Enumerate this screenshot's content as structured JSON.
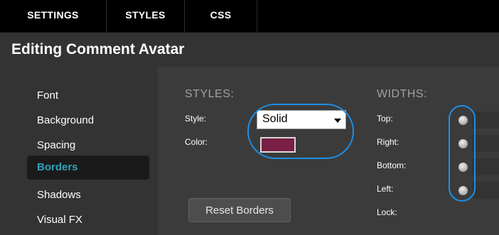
{
  "tabs": {
    "settings": "SETTINGS",
    "styles": "STYLES",
    "css": "CSS"
  },
  "page_title": "Editing Comment Avatar",
  "sidebar": {
    "items": [
      {
        "label": "Font"
      },
      {
        "label": "Background"
      },
      {
        "label": "Spacing"
      },
      {
        "label": "Borders",
        "active": true
      },
      {
        "label": "Shadows"
      },
      {
        "label": "Visual FX"
      }
    ]
  },
  "styles_section": {
    "heading": "STYLES:",
    "style_label": "Style:",
    "style_value": "Solid",
    "color_label": "Color:",
    "color_value": "#7a1f45"
  },
  "widths_section": {
    "heading": "WIDTHS:",
    "labels": {
      "top": "Top:",
      "right": "Right:",
      "bottom": "Bottom:",
      "left": "Left:",
      "lock": "Lock:"
    }
  },
  "reset_button": "Reset Borders",
  "colors": {
    "accent_active": "#2fa3b8",
    "highlight_oval": "#1f8fe6",
    "border_color_swatch": "#7a1f45"
  }
}
